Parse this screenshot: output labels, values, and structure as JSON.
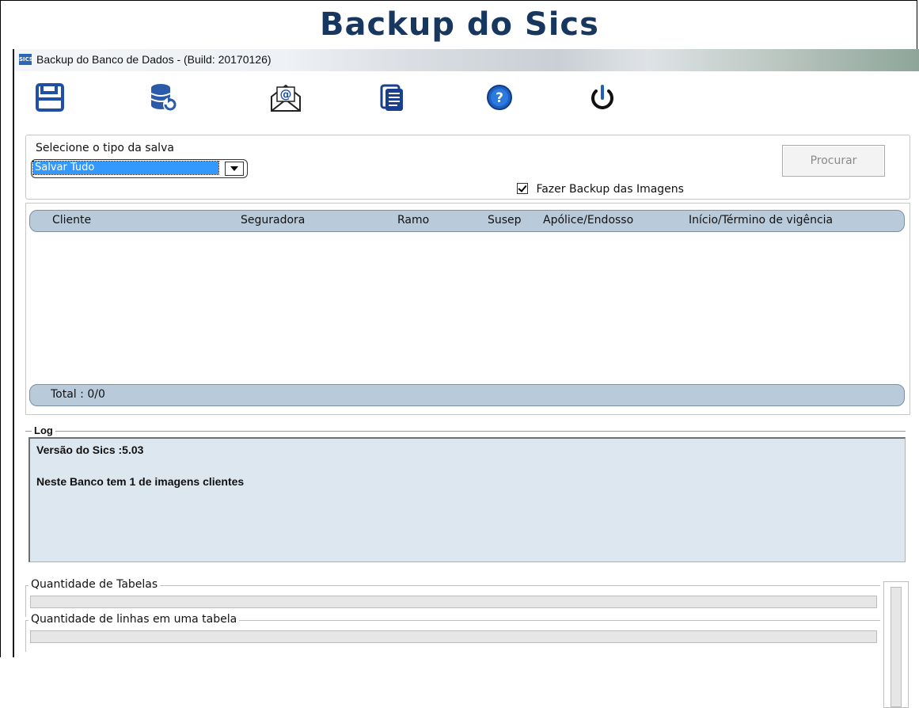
{
  "banner": {
    "title": "Backup do Sics"
  },
  "window": {
    "app_icon_text": "SICS",
    "title": "Backup do Banco de Dados - (Build: 20170126)"
  },
  "toolbar": {
    "buttons": [
      {
        "icon": "save-icon"
      },
      {
        "icon": "database-restore-icon"
      },
      {
        "icon": "email-icon"
      },
      {
        "icon": "copy-documents-icon"
      },
      {
        "icon": "help-icon"
      },
      {
        "icon": "power-icon"
      }
    ]
  },
  "filter": {
    "label": "Selecione o tipo da salva",
    "selected": "Salvar Tudo",
    "checkbox_label": "Fazer Backup das Imagens",
    "checkbox_checked": true,
    "search_button": "Procurar"
  },
  "grid": {
    "columns": [
      "Cliente",
      "Seguradora",
      "Ramo",
      "Susep",
      "Apólice/Endosso",
      "Início/Término de vigência"
    ],
    "rows": [],
    "total_label": "Total : 0/0"
  },
  "log": {
    "legend": "Log",
    "lines": [
      "Versão do Sics :5.03",
      "Neste Banco tem 1 de imagens clientes"
    ]
  },
  "progress": {
    "tables_label": "Quantidade de Tabelas",
    "rows_label": "Quantidade de linhas em uma tabela"
  },
  "colors": {
    "banner_text": "#17375e",
    "grid_header_bg": "#b9cadb",
    "log_bg": "#dde7f0",
    "selection": "#3399ff"
  }
}
